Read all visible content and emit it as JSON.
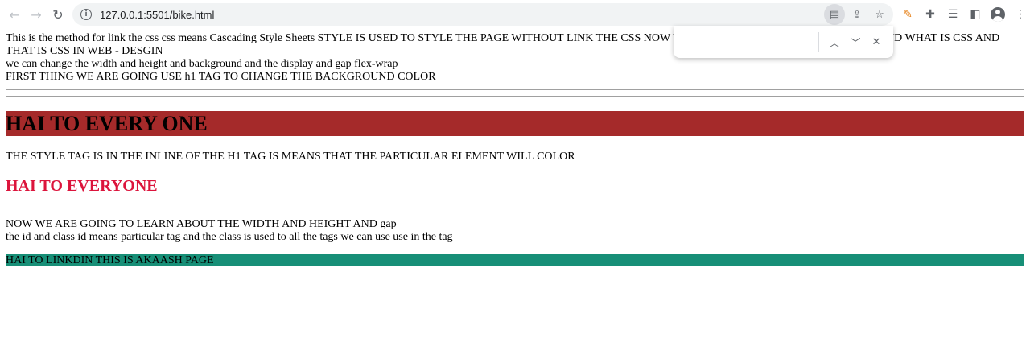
{
  "browser": {
    "url": "127.0.0.1:5501/bike.html",
    "icons": {
      "back": "←",
      "forward": "→",
      "reload": "↻",
      "info": "i",
      "page_doc": "▤",
      "share": "⇪",
      "star": "☆",
      "pen": "✎",
      "puzzle": "✚",
      "reading_list": "☰",
      "side_panel": "◧",
      "menu": "⋮"
    }
  },
  "findbar": {
    "query": "",
    "prev": "︿",
    "next": "﹀",
    "close": "✕"
  },
  "page": {
    "line1": "This is the method for link the css css means Cascading Style Sheets STYLE IS USED TO STYLE THE PAGE WITHOUT LINK THE CSS NOW WE ARE GOING TO LEARN ABOUT CSS AND WHAT IS CSS AND THAT IS CSS IN WEB - DESGIN",
    "line2": "we can change the width and height and background and the display and gap flex-wrap",
    "line3": "FIRST THING WE ARE GOING USE h1 TAG TO CHANGE THE BACKGROUND COLOR",
    "heading1": "HAI TO EVERY ONE",
    "style_text": "THE STYLE TAG IS IN THE INLINE OF THE H1 TAG IS MEANS THAT THE PARTICULAR ELEMENT WILL COLOR",
    "heading2": "HAI TO EVERYONE",
    "width_text": "NOW WE ARE GOING TO LEARN ABOUT THE WIDTH AND HEIGHT AND gap",
    "id_class_text": "the id and class id means particular tag and the class is used to all the tags we can use use in the tag",
    "teal_text": "HAI TO LINKDIN THIS IS AKAASH PAGE"
  },
  "colors": {
    "h1_background": "#a52a2a",
    "h2_color": "#dc143c",
    "teal_background": "#178f77"
  }
}
